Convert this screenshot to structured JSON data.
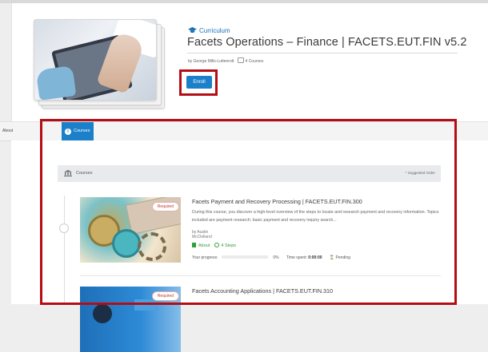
{
  "header": {
    "type_label": "Curriculum",
    "title": "Facets Operations – Finance | FACETS.EUT.FIN v5.2",
    "author": "by George Mills-Luttenrott",
    "course_count": "4 Courses",
    "enroll_label": "Enroll"
  },
  "tabs": [
    {
      "label": "About",
      "active": false
    },
    {
      "label": "Courses",
      "active": true
    }
  ],
  "section": {
    "label": "Courses",
    "order_note": "* Suggested Order"
  },
  "courses": [
    {
      "badge": "Required",
      "title": "Facets Payment and Recovery Processing | FACETS.EUT.FIN.300",
      "description": "During this course, you discover a high-level overview of the steps to locate and research payment and recovery information. Topics included are payment research; basic payment and recovery inquiry search...",
      "author": "by Austin McClelland",
      "about_label": "About",
      "steps_label": "4 Steps",
      "progress_label": "Your progress:",
      "progress_value": "0%",
      "progress_fraction": 0,
      "time_label": "Time spent:",
      "time_value": "0:00:00",
      "status": "Pending"
    },
    {
      "badge": "Required",
      "title": "Facets Accounting Applications | FACETS.EUT.FIN.310"
    }
  ],
  "colors": {
    "accent": "#1b80c9",
    "highlight": "#b50d14",
    "link_green": "#2e9e3c"
  },
  "icons": {
    "curriculum": "graduation-cap-icon",
    "courses_section": "building-icon",
    "about": "book-icon",
    "steps": "steps-icon",
    "status": "hourglass-icon"
  }
}
